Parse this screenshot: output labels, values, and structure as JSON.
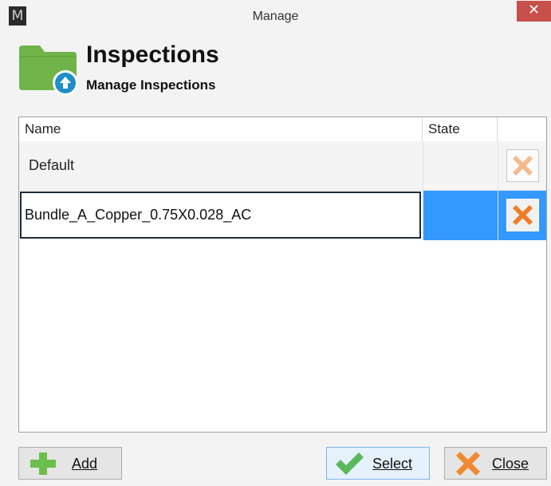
{
  "window": {
    "title": "Manage",
    "app_icon_letter": "M",
    "close_glyph": "✕"
  },
  "header": {
    "title": "Inspections",
    "subtitle": "Manage Inspections",
    "icon": "folder-upload-icon",
    "folder_color": "#70b449",
    "badge_color": "#1e90c8"
  },
  "table": {
    "columns": [
      "Name",
      "State",
      ""
    ],
    "rows": [
      {
        "name": "Default",
        "state": "",
        "selected": false
      },
      {
        "name": "Bundle_A_Copper_0.75X0.028_AC",
        "state": "",
        "selected": true,
        "editing": true
      }
    ],
    "selection_color": "#3399ff",
    "delete_icon": "delete-x-icon"
  },
  "buttons": {
    "add": {
      "label": "Add",
      "icon": "plus-icon",
      "color": "#6bbf4a"
    },
    "select": {
      "label": "Select",
      "icon": "checkmark-icon",
      "color": "#5cb85c"
    },
    "close": {
      "label": "Close",
      "icon": "x-icon",
      "color": "#ee8a2f"
    }
  }
}
